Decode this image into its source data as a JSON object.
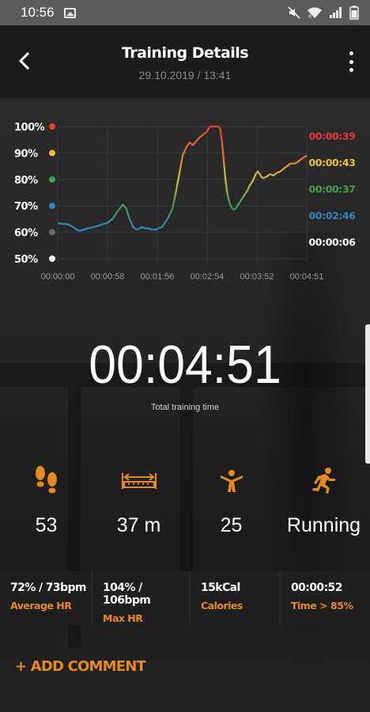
{
  "status_bar": {
    "time": "10:56",
    "icons": [
      "gallery-icon",
      "mute-icon",
      "wifi-icon",
      "signal-icon",
      "battery-icon"
    ]
  },
  "header": {
    "title": "Training Details",
    "subtitle": "29.10.2019 / 13:41",
    "back_icon": "back-arrow-icon",
    "menu_icon": "more-vertical-icon"
  },
  "chart_data": {
    "type": "line",
    "y_ticks": [
      "100%",
      "90%",
      "80%",
      "70%",
      "60%",
      "50%"
    ],
    "y_tick_dot_colors": [
      "#e53935",
      "#f0c030",
      "#43a047",
      "#2e86c1",
      "#6d6d6d",
      "#ffffff"
    ],
    "ylim": [
      50,
      100
    ],
    "x_ticks": [
      "00:00:00",
      "00:00:58",
      "00:01:56",
      "00:02:54",
      "00:03:52",
      "00:04:51"
    ],
    "zone_times": [
      {
        "label": "00:00:39",
        "color": "#e53935"
      },
      {
        "label": "00:00:43",
        "color": "#f0c030"
      },
      {
        "label": "00:00:37",
        "color": "#43a047"
      },
      {
        "label": "00:02:46",
        "color": "#2e86c1"
      },
      {
        "label": "00:00:06",
        "color": "#ffffff"
      }
    ],
    "series": [
      {
        "x": [
          0,
          6,
          12,
          18,
          22,
          26,
          30,
          36,
          42,
          48,
          52,
          58,
          64,
          70,
          76,
          80,
          84,
          88,
          92,
          96,
          98,
          102,
          106,
          110,
          114,
          118,
          122,
          126,
          130,
          134,
          138,
          142,
          146,
          150,
          154,
          158,
          162,
          166,
          170,
          174,
          176,
          178,
          180,
          182,
          184,
          186,
          188,
          190,
          192,
          194,
          196,
          198,
          200,
          202,
          204,
          206,
          208,
          210,
          212,
          214,
          216,
          218,
          220,
          222,
          224,
          226,
          228,
          230,
          232,
          234,
          236,
          238,
          240,
          244,
          248,
          252,
          256,
          260,
          264,
          268,
          272,
          276,
          280,
          284,
          288,
          291
        ],
        "values": [
          63.5,
          63.2,
          63,
          62,
          61,
          60.5,
          61,
          61.5,
          62,
          62.5,
          63,
          63.5,
          65,
          68,
          70.5,
          69,
          65,
          62,
          61,
          61.5,
          62,
          61.5,
          61.5,
          61,
          61,
          61.5,
          62,
          64,
          66,
          69,
          75,
          82,
          89,
          92,
          94,
          93,
          94.5,
          96,
          97,
          98,
          99,
          100,
          100,
          100,
          100,
          100,
          100,
          99,
          94,
          87,
          80,
          75,
          72,
          70,
          69,
          68.5,
          69,
          70,
          71,
          72,
          73,
          74,
          75,
          76,
          77.5,
          78.5,
          79.5,
          81,
          82.5,
          83,
          82,
          81,
          80.5,
          81,
          82,
          81.5,
          82.5,
          83,
          84,
          85,
          86,
          86,
          86.5,
          87.5,
          88.5,
          89
        ]
      }
    ],
    "xlim": [
      0,
      291
    ]
  },
  "summary": {
    "total_time": "00:04:51",
    "total_label": "Total training time"
  },
  "stats": [
    {
      "icon": "footsteps-icon",
      "value": "53"
    },
    {
      "icon": "distance-icon",
      "value": "37 m"
    },
    {
      "icon": "calories-person-icon",
      "value": "25"
    },
    {
      "icon": "running-icon",
      "value": "Running"
    }
  ],
  "metrics": [
    {
      "value": "72% / 73bpm",
      "label": "Average HR"
    },
    {
      "value": "104% / 106bpm",
      "label": "Max HR"
    },
    {
      "value": "15kCal",
      "label": "Calories"
    },
    {
      "value": "00:00:52",
      "label": "Time > 85%"
    }
  ],
  "actions": {
    "add_comment": "+ ADD COMMENT"
  },
  "colors": {
    "accent": "#e6891f",
    "zone_red": "#e53935",
    "zone_yellow": "#f0c030",
    "zone_green": "#43a047",
    "zone_blue": "#2e86c1",
    "zone_gray": "#6d6d6d"
  }
}
